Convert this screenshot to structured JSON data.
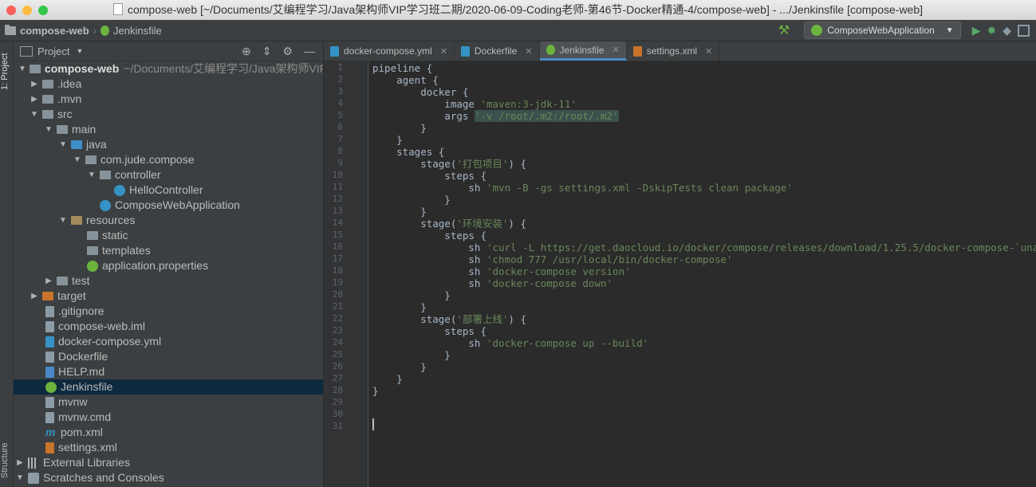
{
  "window": {
    "title": "compose-web [~/Documents/艾编程学习/Java架构师VIP学习班二期/2020-06-09-Coding老师-第46节-Docker精通-4/compose-web] - .../Jenkinsfile [compose-web]"
  },
  "navbar": {
    "project": "compose-web",
    "file": "Jenkinsfile",
    "run_config": "ComposeWebApplication"
  },
  "side_tabs": {
    "project": "1: Project",
    "structure": "Structure"
  },
  "project_panel": {
    "header": "Project",
    "root_name": "compose-web",
    "root_path": "~/Documents/艾编程学习/Java架构师VIP学",
    "items": [
      {
        "label": ".idea"
      },
      {
        "label": ".mvn"
      },
      {
        "label": "src"
      },
      {
        "label": "main"
      },
      {
        "label": "java"
      },
      {
        "label": "com.jude.compose"
      },
      {
        "label": "controller"
      },
      {
        "label": "HelloController"
      },
      {
        "label": "ComposeWebApplication"
      },
      {
        "label": "resources"
      },
      {
        "label": "static"
      },
      {
        "label": "templates"
      },
      {
        "label": "application.properties"
      },
      {
        "label": "test"
      },
      {
        "label": "target"
      },
      {
        "label": ".gitignore"
      },
      {
        "label": "compose-web.iml"
      },
      {
        "label": "docker-compose.yml"
      },
      {
        "label": "Dockerfile"
      },
      {
        "label": "HELP.md"
      },
      {
        "label": "Jenkinsfile"
      },
      {
        "label": "mvnw"
      },
      {
        "label": "mvnw.cmd"
      },
      {
        "label": "pom.xml"
      },
      {
        "label": "settings.xml"
      },
      {
        "label": "External Libraries"
      },
      {
        "label": "Scratches and Consoles"
      }
    ]
  },
  "editor": {
    "tabs": [
      {
        "label": "docker-compose.yml",
        "color": "#3592c4"
      },
      {
        "label": "Dockerfile",
        "color": "#3592c4"
      },
      {
        "label": "Jenkinsfile",
        "color": "#6cb33e"
      },
      {
        "label": "settings.xml",
        "color": "#c8742c"
      }
    ],
    "line_numbers": [
      "1",
      "2",
      "3",
      "4",
      "5",
      "6",
      "7",
      "8",
      "9",
      "10",
      "11",
      "12",
      "13",
      "14",
      "15",
      "16",
      "17",
      "18",
      "19",
      "20",
      "21",
      "22",
      "23",
      "24",
      "25",
      "26",
      "27",
      "28",
      "29",
      "30",
      "31"
    ],
    "lines": [
      {
        "pre": "pipeline {",
        "str": "",
        "post": ""
      },
      {
        "pre": "    agent {",
        "str": "",
        "post": ""
      },
      {
        "pre": "        docker {",
        "str": "",
        "post": ""
      },
      {
        "pre": "            image ",
        "str": "'maven:3-jdk-11'",
        "post": ""
      },
      {
        "pre": "            args ",
        "str": "'-v /root/.m2:/root/.m2'",
        "post": ""
      },
      {
        "pre": "        }",
        "str": "",
        "post": ""
      },
      {
        "pre": "    }",
        "str": "",
        "post": ""
      },
      {
        "pre": "    stages {",
        "str": "",
        "post": ""
      },
      {
        "pre": "        stage(",
        "str": "'打包项目'",
        "post": ") {"
      },
      {
        "pre": "            steps {",
        "str": "",
        "post": ""
      },
      {
        "pre": "                sh ",
        "str": "'mvn -B -gs settings.xml -DskipTests clean package'",
        "post": ""
      },
      {
        "pre": "            }",
        "str": "",
        "post": ""
      },
      {
        "pre": "        }",
        "str": "",
        "post": ""
      },
      {
        "pre": "        stage(",
        "str": "'环境安装'",
        "post": ") {"
      },
      {
        "pre": "            steps {",
        "str": "",
        "post": ""
      },
      {
        "pre": "                sh ",
        "str": "'curl -L https://get.daocloud.io/docker/compose/releases/download/1.25.5/docker-compose-`uname -s`-",
        "post": ""
      },
      {
        "pre": "                sh ",
        "str": "'chmod 777 /usr/local/bin/docker-compose'",
        "post": ""
      },
      {
        "pre": "                sh ",
        "str": "'docker-compose version'",
        "post": ""
      },
      {
        "pre": "                sh ",
        "str": "'docker-compose down'",
        "post": ""
      },
      {
        "pre": "            }",
        "str": "",
        "post": ""
      },
      {
        "pre": "        }",
        "str": "",
        "post": ""
      },
      {
        "pre": "        stage(",
        "str": "'部署上线'",
        "post": ") {"
      },
      {
        "pre": "            steps {",
        "str": "",
        "post": ""
      },
      {
        "pre": "                sh ",
        "str": "'docker-compose up --build'",
        "post": ""
      },
      {
        "pre": "            }",
        "str": "",
        "post": ""
      },
      {
        "pre": "        }",
        "str": "",
        "post": ""
      },
      {
        "pre": "    }",
        "str": "",
        "post": ""
      },
      {
        "pre": "}",
        "str": "",
        "post": ""
      },
      {
        "pre": "",
        "str": "",
        "post": ""
      },
      {
        "pre": "",
        "str": "",
        "post": ""
      },
      {
        "pre": "",
        "str": "",
        "post": ""
      }
    ]
  }
}
